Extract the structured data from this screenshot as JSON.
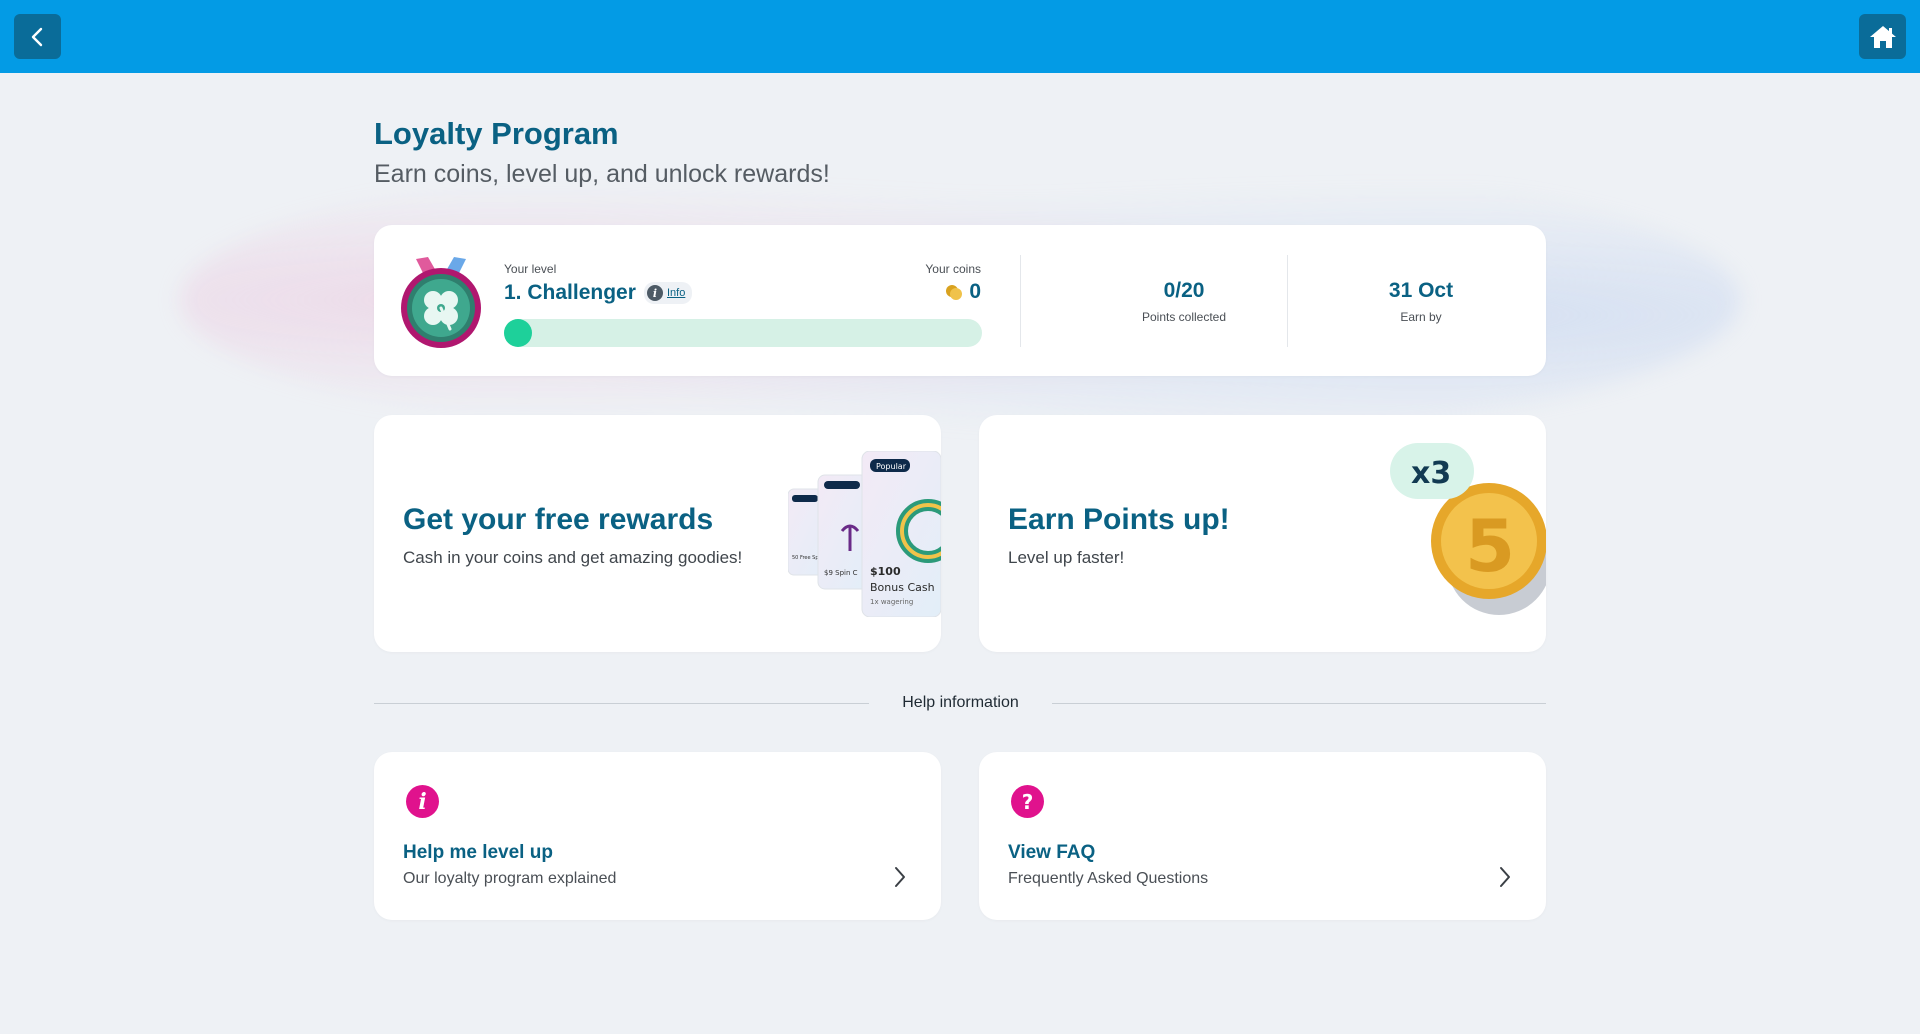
{
  "header": {
    "back_icon": "chevron-left-icon",
    "home_icon": "home-icon",
    "bar_color": "#039be5"
  },
  "page": {
    "title": "Loyalty Program",
    "subtitle": "Earn coins, level up, and unlock rewards!"
  },
  "level_card": {
    "level_label": "Your level",
    "level_name": "1. Challenger",
    "info_label": "Info",
    "coins_label": "Your coins",
    "coins_value": "0",
    "progress_fraction": 0,
    "points_value": "0/20",
    "points_label": "Points collected",
    "earn_by_value": "31 Oct",
    "earn_by_label": "Earn by"
  },
  "promos": [
    {
      "title": "Get your free rewards",
      "subtitle": "Cash in your coins and get amazing goodies!",
      "cards": {
        "tag_front": "Popular",
        "value_front": "$100",
        "name_front": "Bonus Cash",
        "terms_front": "1x wagering",
        "value_mid": "$9 Spin C",
        "value_back": "50 Free Sp"
      }
    },
    {
      "title": "Earn Points up!",
      "subtitle": "Level up faster!",
      "multiplier": "x3",
      "coin_value": "5"
    }
  ],
  "help_section": {
    "label": "Help information",
    "items": [
      {
        "title": "Help me level up",
        "subtitle": "Our loyalty program explained",
        "icon": "info-icon",
        "icon_glyph": "i"
      },
      {
        "title": "View FAQ",
        "subtitle": "Frequently Asked Questions",
        "icon": "question-icon",
        "icon_glyph": "?"
      }
    ]
  }
}
